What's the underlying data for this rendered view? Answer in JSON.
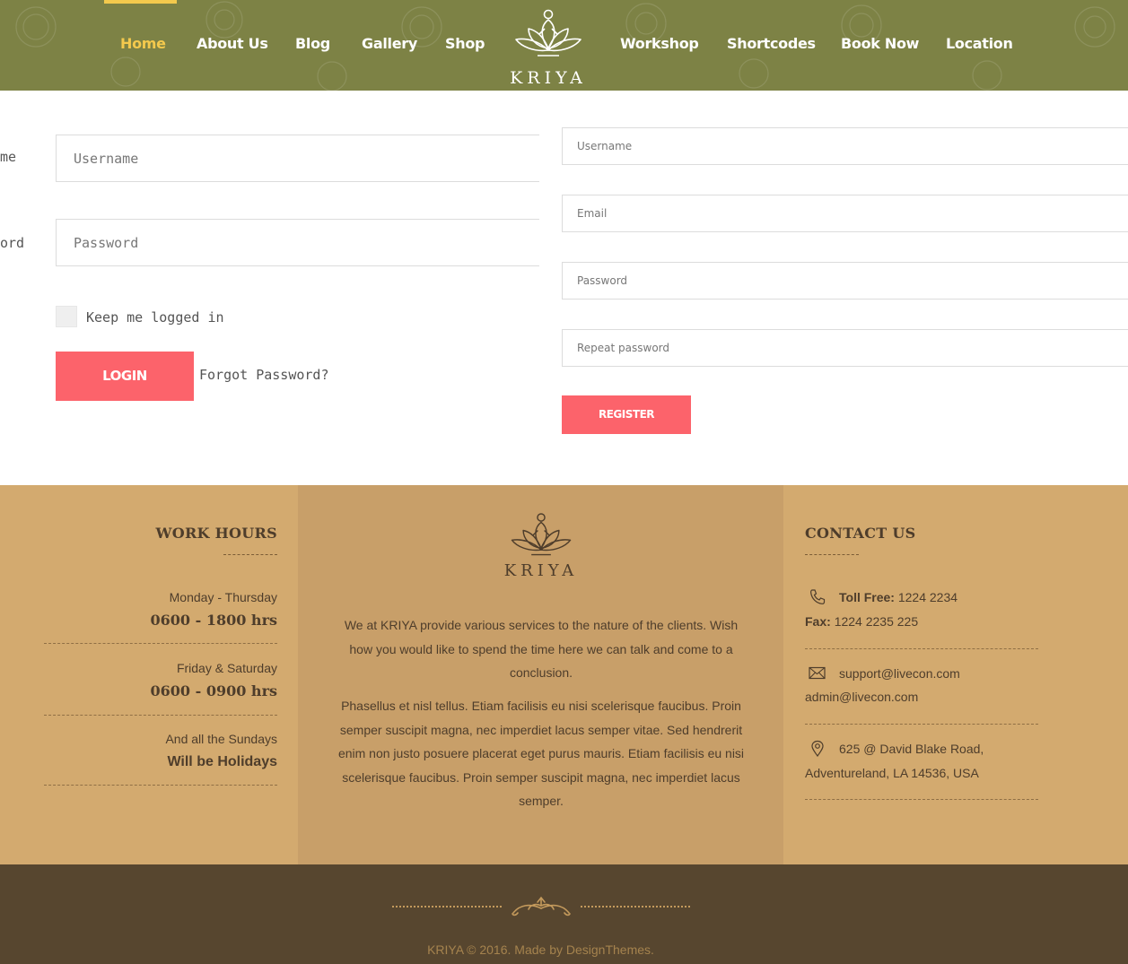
{
  "header": {
    "nav_left": [
      {
        "label": "Home",
        "active": true
      },
      {
        "label": "About Us"
      },
      {
        "label": "Blog"
      },
      {
        "label": "Gallery"
      },
      {
        "label": "Shop"
      }
    ],
    "nav_right": [
      {
        "label": "Workshop"
      },
      {
        "label": "Shortcodes"
      },
      {
        "label": "Book Now"
      },
      {
        "label": "Location"
      }
    ],
    "logo_text": "KRIYA",
    "colors": {
      "bar": "#7d8245",
      "active": "#f3c94d"
    }
  },
  "login": {
    "username_label": "me",
    "password_label": "ord",
    "username_placeholder": "Username",
    "password_placeholder": "Password",
    "remember_label": "Keep me logged in",
    "login_button": "LOGIN",
    "forgot_link": "Forgot Password?"
  },
  "register": {
    "username_placeholder": "Username",
    "email_placeholder": "Email",
    "password_placeholder": "Password",
    "repeat_placeholder": "Repeat password",
    "register_button": "REGISTER",
    "button_color": "#fc636b"
  },
  "footer": {
    "work_hours": {
      "heading": "WORK HOURS",
      "rows": [
        {
          "day": "Monday - Thursday",
          "time": "0600 - 1800 hrs"
        },
        {
          "day": "Friday & Saturday",
          "time": "0600 - 0900 hrs"
        },
        {
          "day": "And all the Sundays",
          "time": "Will be Holidays"
        }
      ]
    },
    "about": {
      "logo_text": "KRIYA",
      "paragraph1": "We at KRIYA provide various services to the nature of the clients. Wish how you would like to spend the time here we can talk and come to a conclusion.",
      "paragraph2": "Phasellus et nisl tellus. Etiam facilisis eu nisi scelerisque faucibus. Proin semper suscipit magna, nec imperdiet lacus semper vitae. Sed hendrerit enim non justo posuere placerat eget purus mauris. Etiam facilisis eu nisi scelerisque faucibus. Proin semper suscipit magna, nec imperdiet lacus semper."
    },
    "contact": {
      "heading": "CONTACT US",
      "toll_free_label": "Toll Free:",
      "toll_free": "1224 2234",
      "fax_label": "Fax:",
      "fax": "1224 2235 225",
      "email1": "support@livecon.com",
      "email2": "admin@livecon.com",
      "address1": "625 @ David Blake Road,",
      "address2": "Adventureland, LA 14536, USA"
    },
    "copyright": "KRIYA © 2016. Made by DesignThemes.",
    "colors": {
      "footer": "#d3aa6f",
      "middle": "#c89f69",
      "bottom": "#57462f"
    }
  }
}
